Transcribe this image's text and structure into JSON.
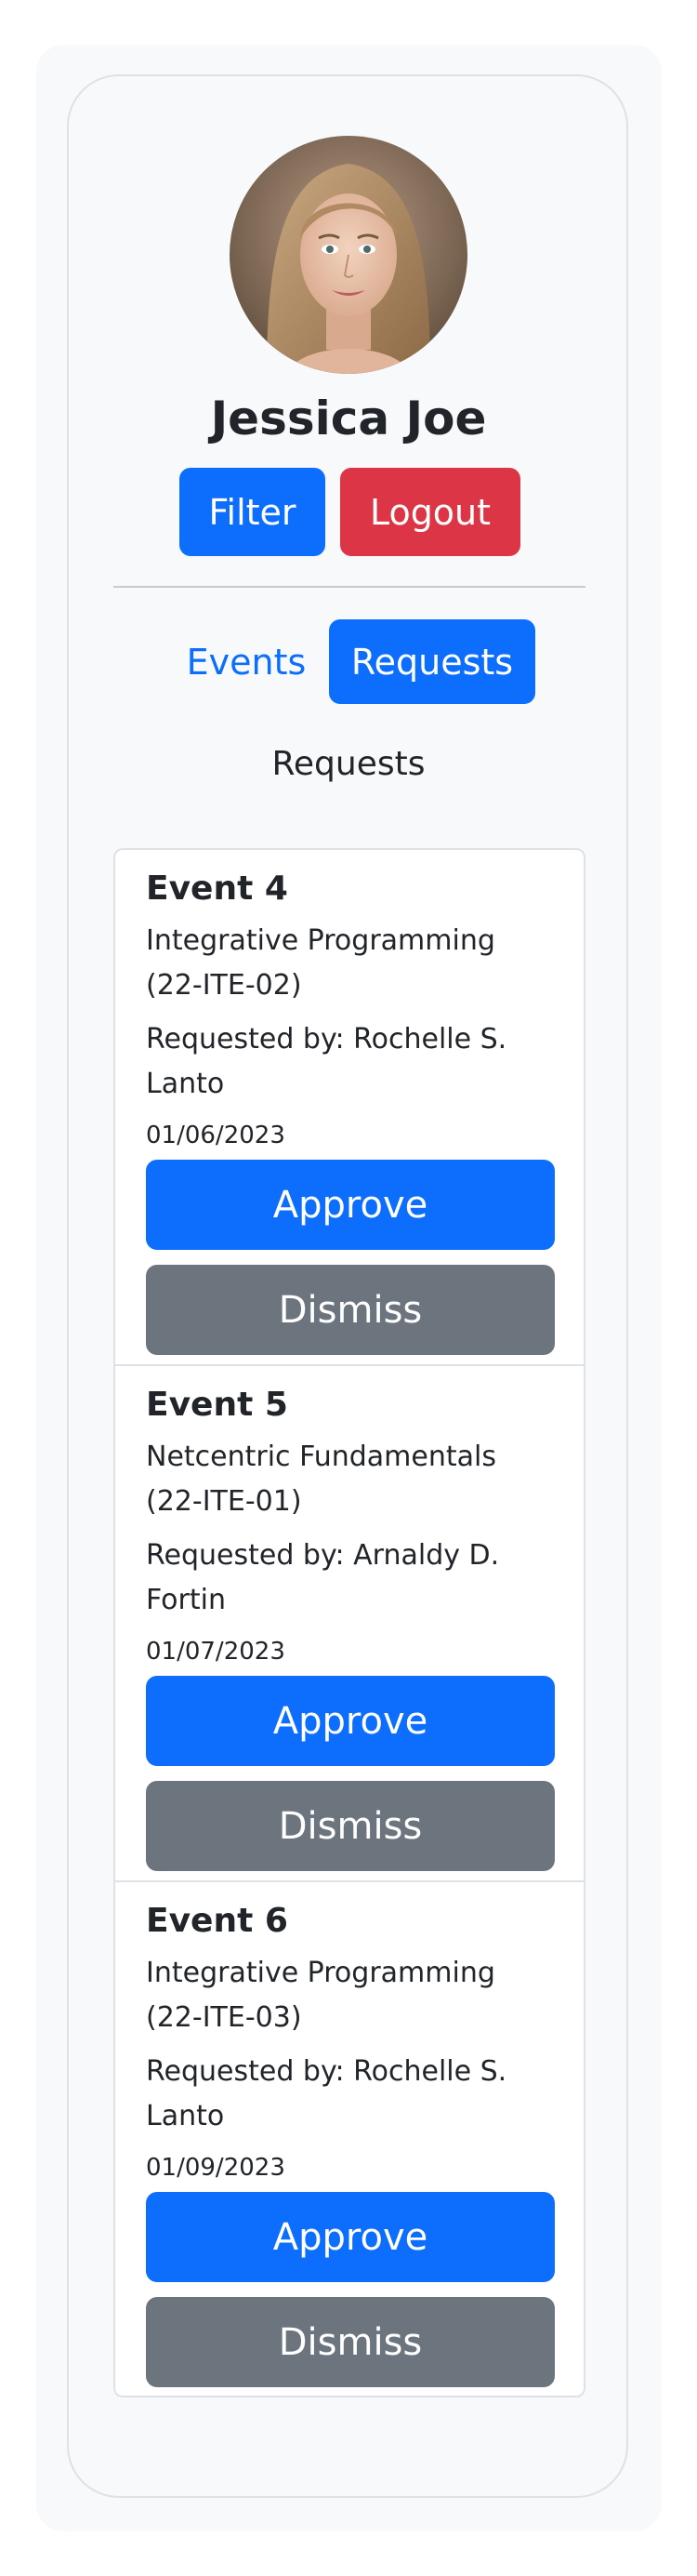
{
  "profile": {
    "name": "Jessica Joe",
    "filter_label": "Filter",
    "logout_label": "Logout"
  },
  "tabs": [
    {
      "label": "Events",
      "active": false
    },
    {
      "label": "Requests",
      "active": true
    }
  ],
  "section_title": "Requests",
  "requests": [
    {
      "title": "Event 4",
      "course": "Integrative Programming (22-ITE-02)",
      "requested_by": "Requested by: Rochelle S. Lanto",
      "date": "01/06/2023",
      "approve_label": "Approve",
      "dismiss_label": "Dismiss"
    },
    {
      "title": "Event 5",
      "course": "Netcentric Fundamentals (22-ITE-01)",
      "requested_by": "Requested by: Arnaldy D. Fortin",
      "date": "01/07/2023",
      "approve_label": "Approve",
      "dismiss_label": "Dismiss"
    },
    {
      "title": "Event 6",
      "course": "Integrative Programming (22-ITE-03)",
      "requested_by": "Requested by: Rochelle S. Lanto",
      "date": "01/09/2023",
      "approve_label": "Approve",
      "dismiss_label": "Dismiss"
    }
  ],
  "colors": {
    "primary": "#0d6efd",
    "danger": "#dc3545",
    "secondary": "#6c757d",
    "panel_bg": "#f8f9fa",
    "border": "#dee2e6"
  }
}
